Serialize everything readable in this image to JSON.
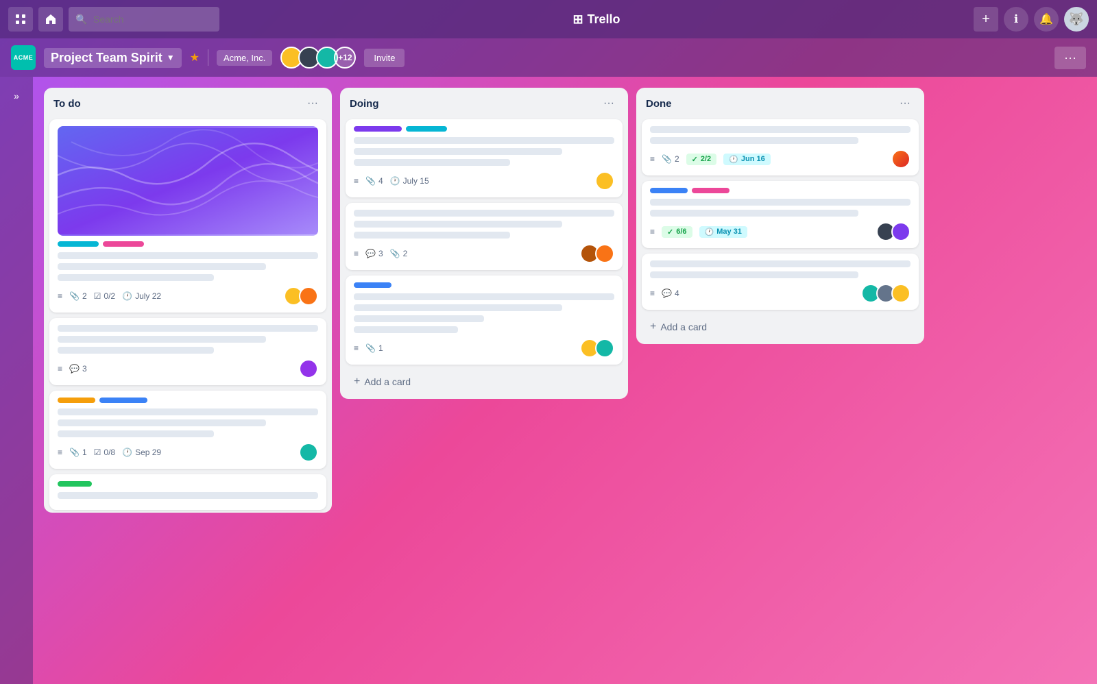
{
  "app": {
    "name": "Trello",
    "logo": "⊞"
  },
  "nav": {
    "grid_icon": "⊞",
    "home_icon": "⌂",
    "search_placeholder": "Search",
    "add_icon": "+",
    "info_icon": "ℹ",
    "bell_icon": "🔔",
    "title": "Trello",
    "more_icon": "···"
  },
  "board": {
    "workspace_abbr": "ACME",
    "title": "Project Team Spirit",
    "workspace_name": "Acme, Inc.",
    "member_count": "+12",
    "invite_label": "Invite",
    "more_label": "···",
    "collapse_icon": "»"
  },
  "columns": [
    {
      "id": "todo",
      "title": "To do",
      "cards": [
        {
          "id": "card1",
          "has_cover": true,
          "tags": [
            "cyan",
            "pink"
          ],
          "lines": [
            "full",
            "medium",
            "short"
          ],
          "meta": {
            "desc": true,
            "attachments": "2",
            "checklist": "0/2",
            "due": "July 22"
          },
          "avatars": [
            "yellow",
            "orange"
          ]
        },
        {
          "id": "card2",
          "has_cover": false,
          "tags": [],
          "lines": [
            "full",
            "medium",
            "short"
          ],
          "meta": {
            "desc": true,
            "comments": "3"
          },
          "avatars": [
            "purple-hair"
          ]
        },
        {
          "id": "card3",
          "has_cover": false,
          "tags": [
            "yellow",
            "blue"
          ],
          "lines": [
            "full",
            "medium",
            "short"
          ],
          "meta": {
            "desc": true,
            "attachments": "1",
            "checklist": "0/8",
            "due": "Sep 29"
          },
          "avatars": [
            "teal"
          ]
        },
        {
          "id": "card4",
          "has_cover": false,
          "tags": [
            "green"
          ],
          "lines": [
            "full"
          ],
          "meta": {},
          "avatars": []
        }
      ]
    },
    {
      "id": "doing",
      "title": "Doing",
      "cards": [
        {
          "id": "dcard1",
          "tags": [
            "purple",
            "cyan"
          ],
          "lines": [
            "full",
            "medium",
            "short"
          ],
          "meta": {
            "desc": true,
            "attachments": "4",
            "due": "July 15"
          },
          "avatars": [
            "yellow"
          ]
        },
        {
          "id": "dcard2",
          "tags": [],
          "lines": [
            "full",
            "medium",
            "short"
          ],
          "meta": {
            "desc": true,
            "comments": "3",
            "attachments": "2"
          },
          "avatars": [
            "pink-hair",
            "orange-beard"
          ]
        },
        {
          "id": "dcard3",
          "tags": [
            "blue"
          ],
          "lines": [
            "full",
            "medium",
            "short",
            "short2"
          ],
          "meta": {
            "desc": true,
            "attachments": "1"
          },
          "avatars": [
            "yellow2",
            "teal2"
          ]
        }
      ],
      "add_card": "Add a card"
    },
    {
      "id": "done",
      "title": "Done",
      "cards": [
        {
          "id": "dncard1",
          "tags": [],
          "lines": [
            "full",
            "medium"
          ],
          "meta": {
            "desc": true,
            "attachments": "2",
            "checklist_done": "2/2",
            "due": "Jun 16"
          },
          "avatars": [
            "orange-beard2"
          ]
        },
        {
          "id": "dncard2",
          "tags": [
            "blue",
            "pink"
          ],
          "lines": [
            "full",
            "medium"
          ],
          "meta": {
            "desc": true,
            "checklist_done": "6/6",
            "due": "May 31"
          },
          "avatars": [
            "dark",
            "purple2"
          ]
        },
        {
          "id": "dncard3",
          "tags": [],
          "lines": [
            "full",
            "medium"
          ],
          "meta": {
            "desc": true,
            "comments": "4"
          },
          "avatars": [
            "teal3",
            "slate",
            "yellow3"
          ]
        }
      ],
      "add_card": "Add a card"
    }
  ]
}
